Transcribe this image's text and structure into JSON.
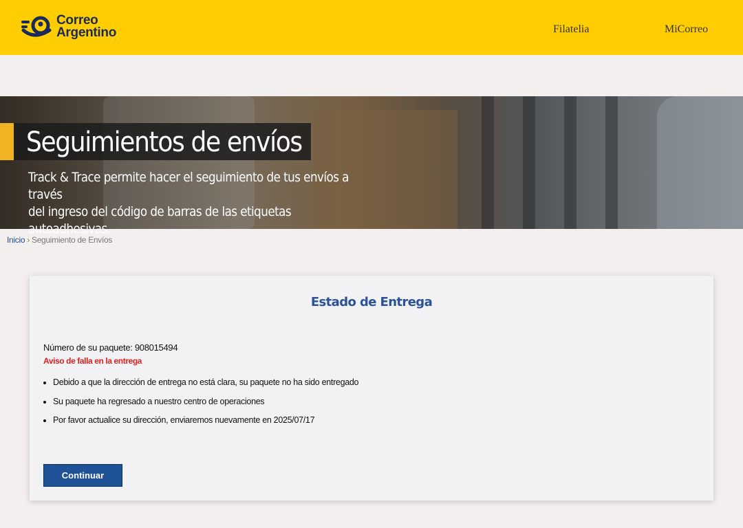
{
  "header": {
    "logo": {
      "line1": "Correo",
      "line2": "Argentino",
      "icon": "correo-argentino-logo-icon"
    },
    "nav": [
      {
        "label": "Filatelia"
      },
      {
        "label": "MiCorreo"
      }
    ]
  },
  "hero": {
    "title": "Seguimientos de envíos",
    "subtitle_line1": "Track & Trace permite hacer el seguimiento de tus envíos a través",
    "subtitle_line2": "del ingreso del código de barras de las etiquetas autoadhesivas."
  },
  "breadcrumb": {
    "home": "Inicio",
    "separator": " › ",
    "current": "Seguimiento de Envíos"
  },
  "card": {
    "title": "Estado de Entrega",
    "package_line": "Número de su paquete: 908015494",
    "alert": "Aviso de falla en la entrega",
    "messages": [
      "Debido a que la dirección de entrega no está clara, su paquete no ha sido entregado",
      "Su paquete ha regresado a nuestro centro de operaciones",
      "Por favor actualice su dirección, enviaremos nuevamente en 2025/07/17"
    ],
    "button_label": "Continuar"
  },
  "colors": {
    "header_bg": "#ffcd00",
    "logo_blue": "#1a2b5b",
    "accent_yellow": "#f0b323",
    "title_blue": "#2a5298",
    "alert_red": "#e0201f",
    "button_blue": "#1f5296",
    "page_bg": "#f2efee"
  }
}
